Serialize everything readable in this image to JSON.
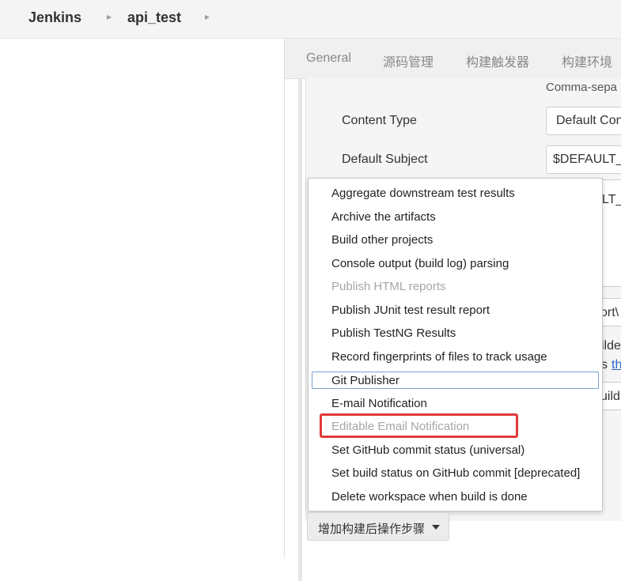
{
  "breadcrumb": {
    "root": "Jenkins",
    "project": "api_test"
  },
  "tabs": [
    "General",
    "源码管理",
    "构建触发器",
    "构建环境"
  ],
  "config": {
    "hint_text": "Comma-sepa",
    "content_type_label": "Content Type",
    "content_type_value": "Default Con",
    "default_subject_label": "Default Subject",
    "default_subject_value": "$DEFAULT_",
    "default_content_fragment": "LT_",
    "fragment_report": "ort\\",
    "fragment_builde": "ilde",
    "fragment_s": "s",
    "fragment_link": "th",
    "fragment_build": "uild"
  },
  "menu": {
    "items": [
      {
        "label": "Aggregate downstream test results",
        "disabled": false
      },
      {
        "label": "Archive the artifacts",
        "disabled": false
      },
      {
        "label": "Build other projects",
        "disabled": false
      },
      {
        "label": "Console output (build log) parsing",
        "disabled": false
      },
      {
        "label": "Publish HTML reports",
        "disabled": true
      },
      {
        "label": "Publish JUnit test result report",
        "disabled": false
      },
      {
        "label": "Publish TestNG Results",
        "disabled": false
      },
      {
        "label": "Record fingerprints of files to track usage",
        "disabled": false
      },
      {
        "label": "Git Publisher",
        "disabled": false,
        "focused": true
      },
      {
        "label": "E-mail Notification",
        "disabled": false
      },
      {
        "label": "Editable Email Notification",
        "disabled": true,
        "highlighted": true
      },
      {
        "label": "Set GitHub commit status (universal)",
        "disabled": false
      },
      {
        "label": "Set build status on GitHub commit [deprecated]",
        "disabled": false
      },
      {
        "label": "Delete workspace when build is done",
        "disabled": false
      }
    ]
  },
  "add_post_build": {
    "label": "增加构建后操作步骤",
    "icon": "caret-down-icon"
  },
  "colors": {
    "highlight": "#e03a3a",
    "focus": "#7aa3d6",
    "link": "#2a67c9"
  }
}
